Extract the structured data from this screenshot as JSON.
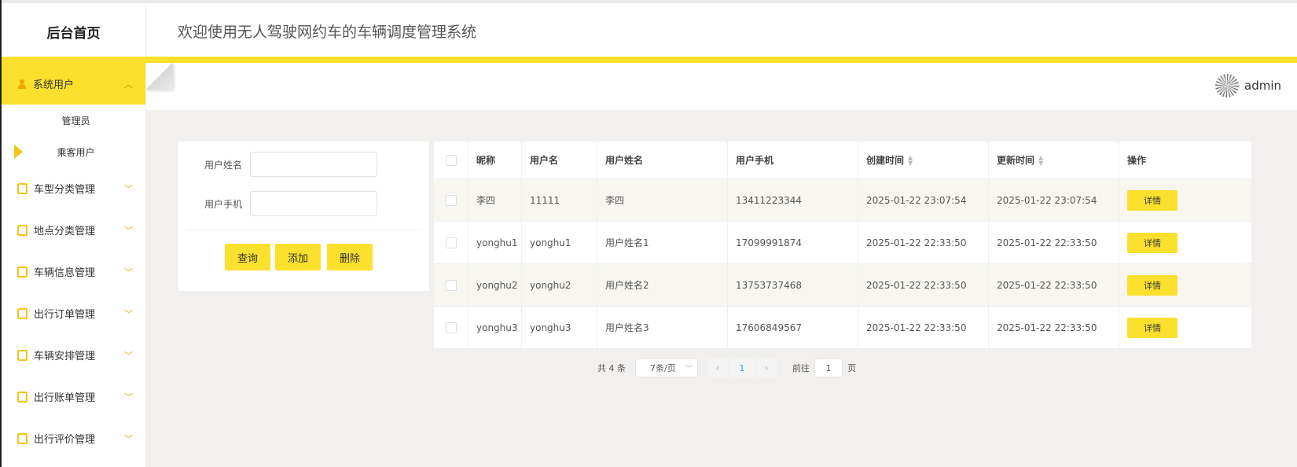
{
  "header": {
    "logo": "后台首页",
    "title": "欢迎使用无人驾驶网约车的车辆调度管理系统"
  },
  "user": {
    "name": "admin"
  },
  "sidebar": {
    "items": [
      {
        "label": "系统用户",
        "icon": "user-icon",
        "active": true,
        "sub": [
          {
            "label": "管理员"
          },
          {
            "label": "乘客用户",
            "current": true
          }
        ]
      },
      {
        "label": "车型分类管理",
        "icon": "page-icon"
      },
      {
        "label": "地点分类管理",
        "icon": "page-icon"
      },
      {
        "label": "车辆信息管理",
        "icon": "page-icon"
      },
      {
        "label": "出行订单管理",
        "icon": "page-icon"
      },
      {
        "label": "车辆安排管理",
        "icon": "page-icon"
      },
      {
        "label": "出行账单管理",
        "icon": "page-icon"
      },
      {
        "label": "出行评价管理",
        "icon": "page-icon"
      }
    ]
  },
  "search": {
    "name_label": "用户姓名",
    "name_value": "",
    "phone_label": "用户手机",
    "phone_value": "",
    "query_button": "查询",
    "add_button": "添加",
    "delete_button": "删除"
  },
  "table": {
    "columns": [
      "昵称",
      "用户名",
      "用户姓名",
      "用户手机",
      "创建时间",
      "更新时间",
      "操作"
    ],
    "detail_label": "详情",
    "rows": [
      {
        "nickname": "李四",
        "username": "11111",
        "realname": "李四",
        "phone": "13411223344",
        "created": "2025-01-22 23:07:54",
        "updated": "2025-01-22 23:07:54"
      },
      {
        "nickname": "yonghu1",
        "username": "yonghu1",
        "realname": "用户姓名1",
        "phone": "17099991874",
        "created": "2025-01-22 22:33:50",
        "updated": "2025-01-22 22:33:50"
      },
      {
        "nickname": "yonghu2",
        "username": "yonghu2",
        "realname": "用户姓名2",
        "phone": "13753737468",
        "created": "2025-01-22 22:33:50",
        "updated": "2025-01-22 22:33:50"
      },
      {
        "nickname": "yonghu3",
        "username": "yonghu3",
        "realname": "用户姓名3",
        "phone": "17606849567",
        "created": "2025-01-22 22:33:50",
        "updated": "2025-01-22 22:33:50"
      }
    ]
  },
  "pagination": {
    "total": "共 4 条",
    "page_size": "7条/页",
    "current_page": "1",
    "goto_prefix": "前往",
    "goto_value": "1",
    "goto_suffix": "页"
  },
  "colors": {
    "accent": "#fbe02e",
    "link": "#409eff"
  }
}
